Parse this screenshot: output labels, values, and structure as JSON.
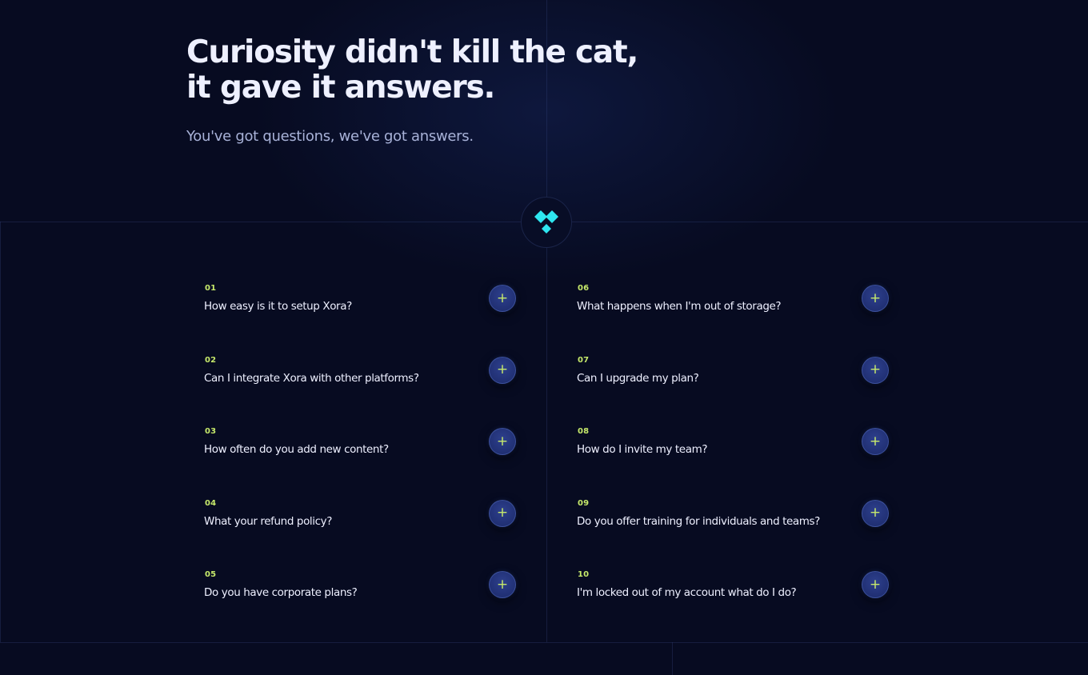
{
  "header": {
    "headline_line1": "Curiosity didn't kill the cat,",
    "headline_line2": "it gave it answers.",
    "subhead": "You've got questions, we've got answers."
  },
  "colors": {
    "background": "#070b21",
    "accent": "#c6e96b",
    "logo": "#2ee6f0",
    "button": "#1c2a6a"
  },
  "logo": {
    "icon": "xora-diamond-logo-icon"
  },
  "faq_left": [
    {
      "num": "01",
      "question": "How easy is it to setup Xora?",
      "icon": "plus-icon"
    },
    {
      "num": "02",
      "question": "Can I integrate Xora with other platforms?",
      "icon": "plus-icon"
    },
    {
      "num": "03",
      "question": "How often do you add new content?",
      "icon": "plus-icon"
    },
    {
      "num": "04",
      "question": "What your refund policy?",
      "icon": "plus-icon"
    },
    {
      "num": "05",
      "question": "Do you have corporate plans?",
      "icon": "plus-icon"
    }
  ],
  "faq_right": [
    {
      "num": "06",
      "question": "What happens when I'm out of storage?",
      "icon": "plus-icon"
    },
    {
      "num": "07",
      "question": "Can I upgrade my plan?",
      "icon": "plus-icon"
    },
    {
      "num": "08",
      "question": "How do I invite my team?",
      "icon": "plus-icon"
    },
    {
      "num": "09",
      "question": "Do you offer training for individuals and teams?",
      "icon": "plus-icon"
    },
    {
      "num": "10",
      "question": "I'm locked out of my account what do I do?",
      "icon": "plus-icon"
    }
  ],
  "toggle_symbol": "+"
}
